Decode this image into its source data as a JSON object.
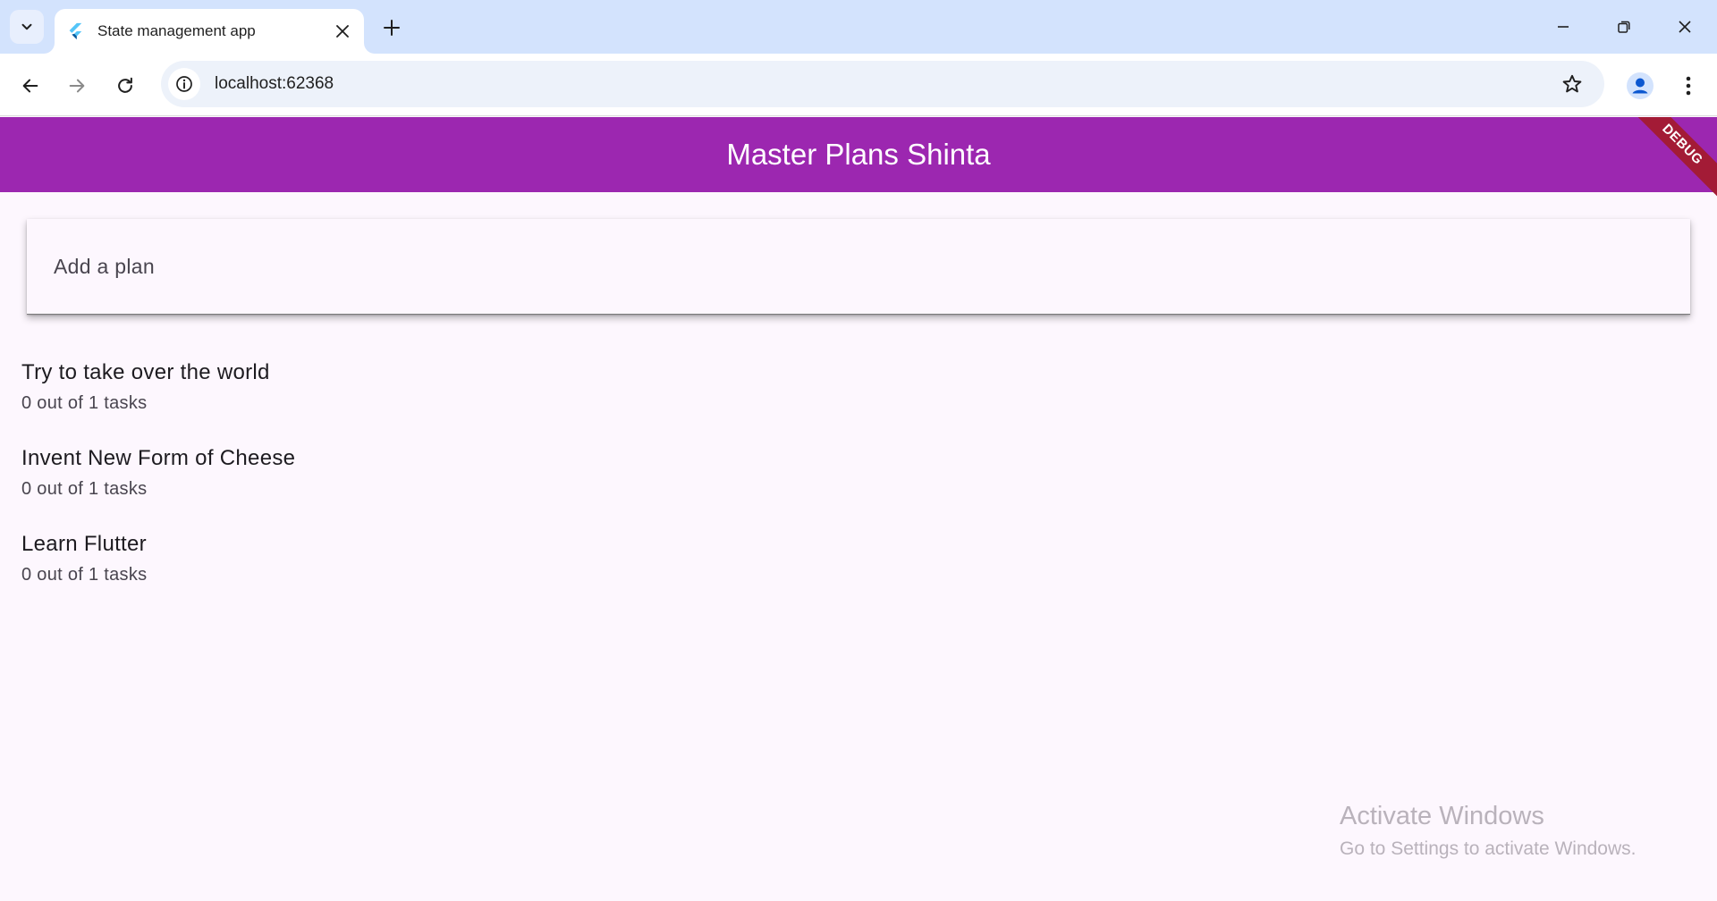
{
  "browser": {
    "tab_title": "State management app",
    "url": "localhost:62368"
  },
  "app": {
    "title": "Master Plans Shinta",
    "debug_label": "DEBUG",
    "add_plan_placeholder": "Add a plan",
    "plans": [
      {
        "name": "Try to take over the world",
        "progress": "0 out of 1 tasks"
      },
      {
        "name": "Invent New Form of Cheese",
        "progress": "0 out of 1 tasks"
      },
      {
        "name": "Learn Flutter",
        "progress": "0 out of 1 tasks"
      }
    ]
  },
  "watermark": {
    "title": "Activate Windows",
    "subtitle": "Go to Settings to activate Windows."
  },
  "colors": {
    "appbar": "#9c27b0",
    "background": "#fdf7fe",
    "tabstrip": "#d3e3fd",
    "debug_banner": "#a31b36"
  },
  "icons": {
    "tab_search": "chevron-down-icon",
    "favicon": "flutter-icon",
    "close": "close-icon",
    "new_tab": "plus-icon",
    "back": "arrow-left-icon",
    "forward": "arrow-right-icon",
    "reload": "reload-icon",
    "site_info": "info-icon",
    "bookmark": "star-icon",
    "profile": "person-icon",
    "menu": "more-vert-icon"
  }
}
